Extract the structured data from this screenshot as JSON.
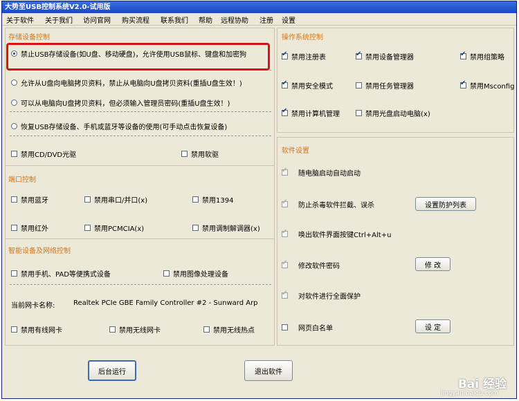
{
  "window": {
    "title": "大势至USB控制系统V2.0-试用版"
  },
  "menu": [
    "关于软件",
    "关于我们",
    "访问官网",
    "购买流程",
    "联系我们",
    "帮助",
    "远程协助",
    "注册",
    "设置"
  ],
  "storage": {
    "title": "存储设备控制",
    "options": [
      "禁止USB存储设备(如U盘、移动硬盘)，允许使用USB鼠标、键盘和加密狗",
      "允许从U盘向电脑拷贝资料，禁止从电脑向U盘拷贝资料(重插U盘生效！)",
      "可以从电脑向U盘拷贝资料，但必须输入管理员密码(重插U盘生效！)",
      "恢复USB存储设备、手机或蓝牙等设备的使用(可手动点击恢复设备)"
    ],
    "cd": "禁用CD/DVD光驱",
    "floppy": "禁用软驱"
  },
  "port": {
    "title": "端口控制",
    "items": [
      "禁用蓝牙",
      "禁用串口/并口(x)",
      "禁用1394",
      "禁用红外",
      "禁用PCMCIA(x)",
      "禁用调制解调器(x)"
    ]
  },
  "smart": {
    "title": "智能设备及网络控制",
    "phone": "禁用手机、PAD等便携式设备",
    "image": "禁用图像处理设备",
    "nic_label": "当前网卡名称:",
    "nic_value": "Realtek PCIe GBE Family Controller #2 - Sunward Arp",
    "wired": "禁用有线网卡",
    "wireless": "禁用无线网卡",
    "hotspot": "禁用无线热点"
  },
  "os": {
    "title": "操作系统控制",
    "items": [
      "禁用注册表",
      "禁用设备管理器",
      "禁用组策略",
      "禁用安全模式",
      "禁用任务管理器",
      "禁用Msconfig",
      "禁用计算机管理",
      "禁用光盘启动电脑(x)"
    ]
  },
  "software": {
    "title": "软件设置",
    "items": [
      "随电脑启动自动启动",
      "防止杀毒软件拦截、误杀",
      "唤出软件界面按键Ctrl+Alt+u",
      "修改软件密码",
      "对软件进行全面保护",
      "网页白名单"
    ],
    "btn_protect": "设置防护列表",
    "btn_modify": "修 改",
    "btn_set": "设 定"
  },
  "buttons": {
    "background": "后台运行",
    "exit": "退出软件"
  },
  "watermark": {
    "brand": "Bai 经验",
    "url": "jingyan.baidu.com"
  }
}
